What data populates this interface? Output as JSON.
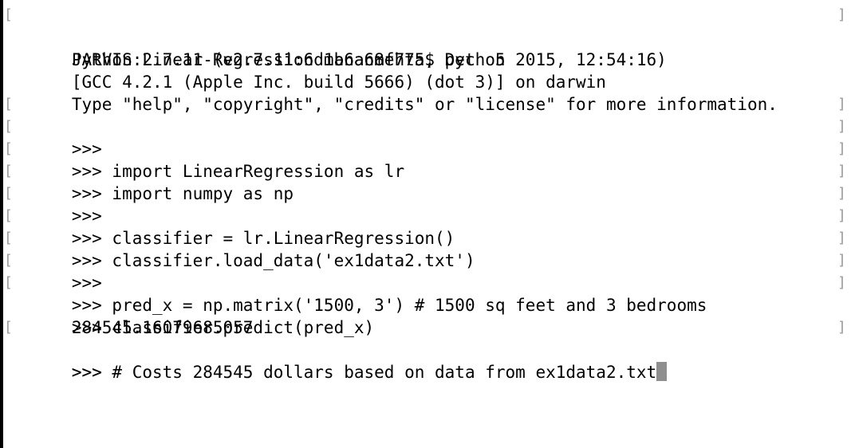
{
  "terminal": {
    "bracket_left": "[",
    "bracket_right": "]",
    "cursor_color": "#8e8e8e",
    "lines": [
      {
        "text": "JARVIS:Linear-Regression mananmehta$ python"
      },
      {
        "text": "Python 2.7.11 (v2.7.11:6d1b6a68f775, Dec  5 2015, 12:54:16)"
      },
      {
        "text": "[GCC 4.2.1 (Apple Inc. build 5666) (dot 3)] on darwin"
      },
      {
        "text": "Type \"help\", \"copyright\", \"credits\" or \"license\" for more information."
      },
      {
        "text": ">>>"
      },
      {
        "text": ">>> import LinearRegression as lr"
      },
      {
        "text": ">>> import numpy as np"
      },
      {
        "text": ">>>"
      },
      {
        "text": ">>> classifier = lr.LinearRegression()"
      },
      {
        "text": ">>> classifier.load_data('ex1data2.txt')"
      },
      {
        "text": ">>>"
      },
      {
        "text": ">>> pred_x = np.matrix('1500, 3') # 1500 sq feet and 3 bedrooms"
      },
      {
        "text": ">>> classifier.predict(pred_x)"
      },
      {
        "text": "284545.16079685057"
      },
      {
        "text": ">>>"
      },
      {
        "text": ">>> # Costs 284545 dollars based on data from ex1data2.txt"
      }
    ]
  }
}
